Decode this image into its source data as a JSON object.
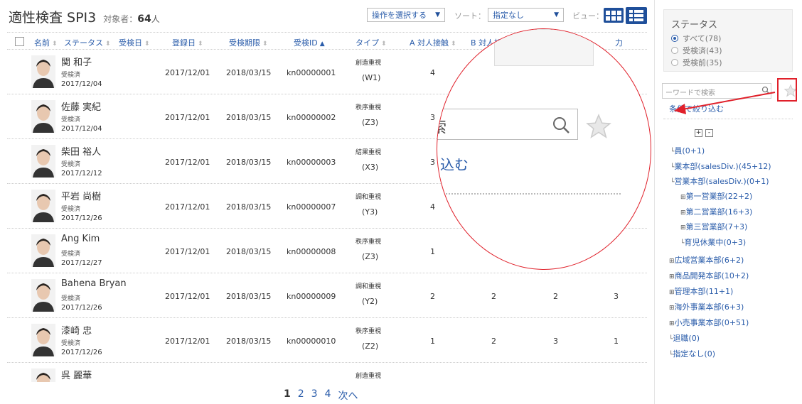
{
  "header": {
    "title": "適性検査 SPI3",
    "target_label": "対象者：",
    "target_count": "64",
    "target_unit": "人",
    "operation_select": "操作を選択する",
    "sort_label": "ソート：",
    "sort_select": "指定なし",
    "view_label": "ビュー："
  },
  "columns": {
    "name": "名前",
    "status": "ステータス",
    "exam_date": "受検日",
    "registered": "登録日",
    "deadline": "受検期限",
    "exam_id": "受検ID",
    "type": "タイプ",
    "a": "A 対人接触",
    "b": "B 対人折",
    "last": "力"
  },
  "rows": [
    {
      "name": "関 和子",
      "status": "受検済",
      "date": "2017/12/04",
      "registered": "2017/12/01",
      "deadline": "2018/03/15",
      "id": "kn00000001",
      "type_a": "創造重視",
      "type_b": "(W1)",
      "a": "4",
      "b": "",
      "c": "",
      "d": ""
    },
    {
      "name": "佐藤 実紀",
      "status": "受検済",
      "date": "2017/12/04",
      "registered": "2017/12/01",
      "deadline": "2018/03/15",
      "id": "kn00000002",
      "type_a": "秩序重視",
      "type_b": "(Z3)",
      "a": "3",
      "b": "",
      "c": "",
      "d": ""
    },
    {
      "name": "柴田 裕人",
      "status": "受検済",
      "date": "2017/12/12",
      "registered": "2017/12/01",
      "deadline": "2018/03/15",
      "id": "kn00000003",
      "type_a": "結果重視",
      "type_b": "(X3)",
      "a": "3",
      "b": "",
      "c": "",
      "d": ""
    },
    {
      "name": "平岩 尚樹",
      "status": "受検済",
      "date": "2017/12/26",
      "registered": "2017/12/01",
      "deadline": "2018/03/15",
      "id": "kn00000007",
      "type_a": "調和重視",
      "type_b": "(Y3)",
      "a": "4",
      "b": "",
      "c": "",
      "d": ""
    },
    {
      "name": "Ang Kim",
      "status": "受検済",
      "date": "2017/12/27",
      "registered": "2017/12/01",
      "deadline": "2018/03/15",
      "id": "kn00000008",
      "type_a": "秩序重視",
      "type_b": "(Z3)",
      "a": "1",
      "b": "",
      "c": "",
      "d": ""
    },
    {
      "name": "Bahena Bryan",
      "status": "受検済",
      "date": "2017/12/26",
      "registered": "2017/12/01",
      "deadline": "2018/03/15",
      "id": "kn00000009",
      "type_a": "調和重視",
      "type_b": "(Y2)",
      "a": "2",
      "b": "2",
      "c": "2",
      "d": "3"
    },
    {
      "name": "漆崎 忠",
      "status": "受検済",
      "date": "2017/12/26",
      "registered": "2017/12/01",
      "deadline": "2018/03/15",
      "id": "kn00000010",
      "type_a": "秩序重視",
      "type_b": "(Z2)",
      "a": "1",
      "b": "2",
      "c": "3",
      "d": "1"
    },
    {
      "name": "呉 麗華",
      "status": "",
      "date": "",
      "registered": "",
      "deadline": "",
      "id": "",
      "type_a": "創造重視",
      "type_b": "",
      "a": "",
      "b": "",
      "c": "",
      "d": ""
    }
  ],
  "pagination": {
    "current": "1",
    "p2": "2",
    "p3": "3",
    "p4": "4",
    "next": "次へ"
  },
  "sidebar": {
    "status_title": "ステータス",
    "radios": [
      "すべて(78)",
      "受検済(43)",
      "受検前(35)"
    ],
    "search_placeholder": "ーワードで検索",
    "filter_link": "条件で絞り込む",
    "tree": [
      "員(0+1)",
      "業本部(salesDiv.)(45+12)",
      "営業本部(salesDiv.)(0+1)",
      "第一営業部(22+2)",
      "第二営業部(16+3)",
      "第三営業部(7+3)",
      "育児休業中(0+3)",
      "広域営業本部(6+2)",
      "商品開発本部(10+2)",
      "管理本部(11+1)",
      "海外事業本部(6+3)",
      "小売事業本部(0+51)",
      "退職(0)",
      "指定なし(0)"
    ]
  },
  "magnifier": {
    "search_text": "索",
    "link_text": "込む"
  },
  "colors": {
    "accent": "#2a5caa",
    "view_button": "#1f4f9a",
    "highlight": "#e0202a"
  }
}
